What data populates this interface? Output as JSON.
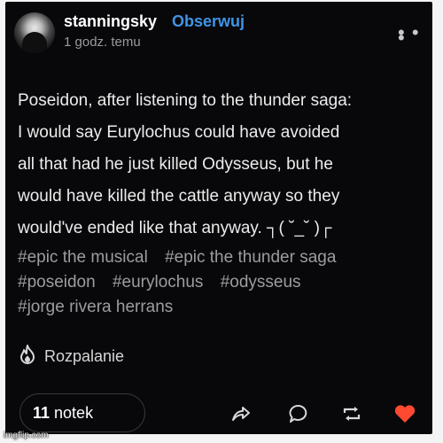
{
  "post": {
    "username": "stanningsky",
    "follow_label": "Obserwuj",
    "time_ago": "1 godz. temu",
    "more_icon": "ellipsis-icon",
    "text_lines": [
      "Poseidon, after listening to the thunder saga:",
      "I would say Eurylochus could have avoided",
      "all that had he  just killed Odysseus, but he",
      "would have killed the cattle anyway so they",
      "would've ended like that anyway. ┐( ˘_˘ )┌"
    ],
    "tags_rows": [
      [
        "#epic the musical",
        "#epic the thunder saga"
      ],
      [
        "#poseidon",
        "#eurylochus",
        "#odysseus"
      ],
      [
        "#jorge rivera herrans"
      ]
    ],
    "blaze_label": "Rozpalanie",
    "notes_count": "11",
    "notes_label": "notek"
  },
  "colors": {
    "card_bg": "#08080b",
    "follow_blue": "#3f95e6",
    "like_red": "#ff4930",
    "tag_gray": "#9d9d9d"
  },
  "watermark": "imgflip.com"
}
